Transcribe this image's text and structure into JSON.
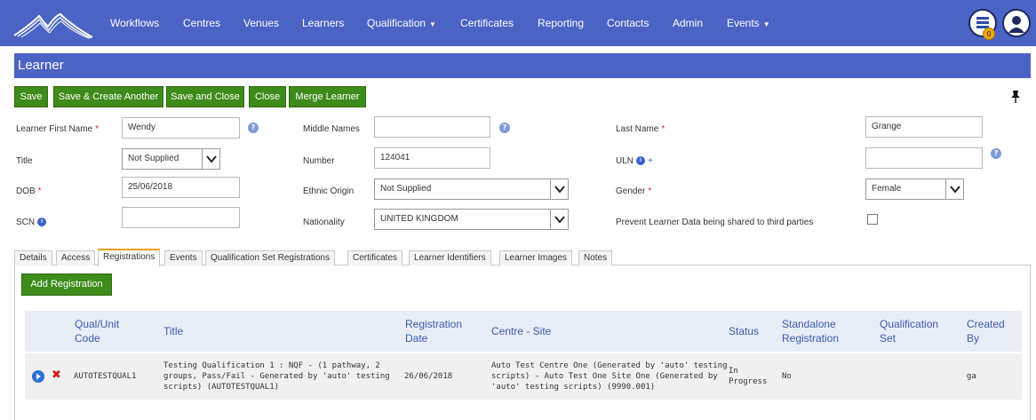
{
  "nav": {
    "items": [
      "Workflows",
      "Centres",
      "Venues",
      "Learners",
      "Qualification",
      "Certificates",
      "Reporting",
      "Contacts",
      "Admin",
      "Events"
    ],
    "notification_count": "0"
  },
  "header": {
    "title": "Learner"
  },
  "toolbar": {
    "save": "Save",
    "save_create": "Save & Create Another",
    "save_close": "Save and Close",
    "close": "Close",
    "merge": "Merge Learner"
  },
  "form": {
    "first_name_label": "Learner First Name",
    "first_name_value": "Wendy",
    "middle_names_label": "Middle Names",
    "middle_names_value": "",
    "last_name_label": "Last Name",
    "last_name_value": "Grange",
    "title_label": "Title",
    "title_value": "Not Supplied",
    "number_label": "Number",
    "number_value": "124041",
    "uln_label": "ULN",
    "uln_value": "",
    "dob_label": "DOB",
    "dob_value": "25/06/2018",
    "ethnic_label": "Ethnic Origin",
    "ethnic_value": "Not Supplied",
    "gender_label": "Gender",
    "gender_value": "Female",
    "scn_label": "SCN",
    "scn_value": "",
    "nationality_label": "Nationality",
    "nationality_value": "UNITED KINGDOM",
    "prevent_label": "Prevent Learner Data being shared to third parties",
    "required_mark": "*"
  },
  "tabs": [
    "Details",
    "Access",
    "Registrations",
    "Events",
    "Qualification Set Registrations",
    "Certificates",
    "Learner Identifiers",
    "Learner Images",
    "Notes"
  ],
  "active_tab": "Registrations",
  "registrations": {
    "add_label": "Add Registration",
    "headers": {
      "code": [
        "Qual/Unit",
        "Code"
      ],
      "title": "Title",
      "date": [
        "Registration",
        "Date"
      ],
      "centre": "Centre - Site",
      "status": "Status",
      "standalone": [
        "Standalone",
        "Registration"
      ],
      "qualset": [
        "Qualification",
        "Set"
      ],
      "created": [
        "Created",
        "By"
      ]
    },
    "rows": [
      {
        "code": "AUTOTESTQUAL1",
        "title": [
          "Testing Qualification 1 : NQF - (1 pathway, 2",
          "groups, Pass/Fail - Generated by 'auto' testing",
          "scripts) (AUTOTESTQUAL1)"
        ],
        "date": "26/06/2018",
        "centre": [
          "Auto Test Centre One (Generated by 'auto' testing",
          "scripts) - Auto Test One Site One (Generated by",
          "'auto' testing scripts) (9990.001)"
        ],
        "status": [
          "In",
          "Progress"
        ],
        "standalone": "No",
        "qualset": "",
        "created": "ga"
      }
    ]
  },
  "colors": {
    "nav": "#4a63c4",
    "button": "#3d8b1a",
    "header_text": "#3a5aad",
    "required": "#dd2222"
  }
}
